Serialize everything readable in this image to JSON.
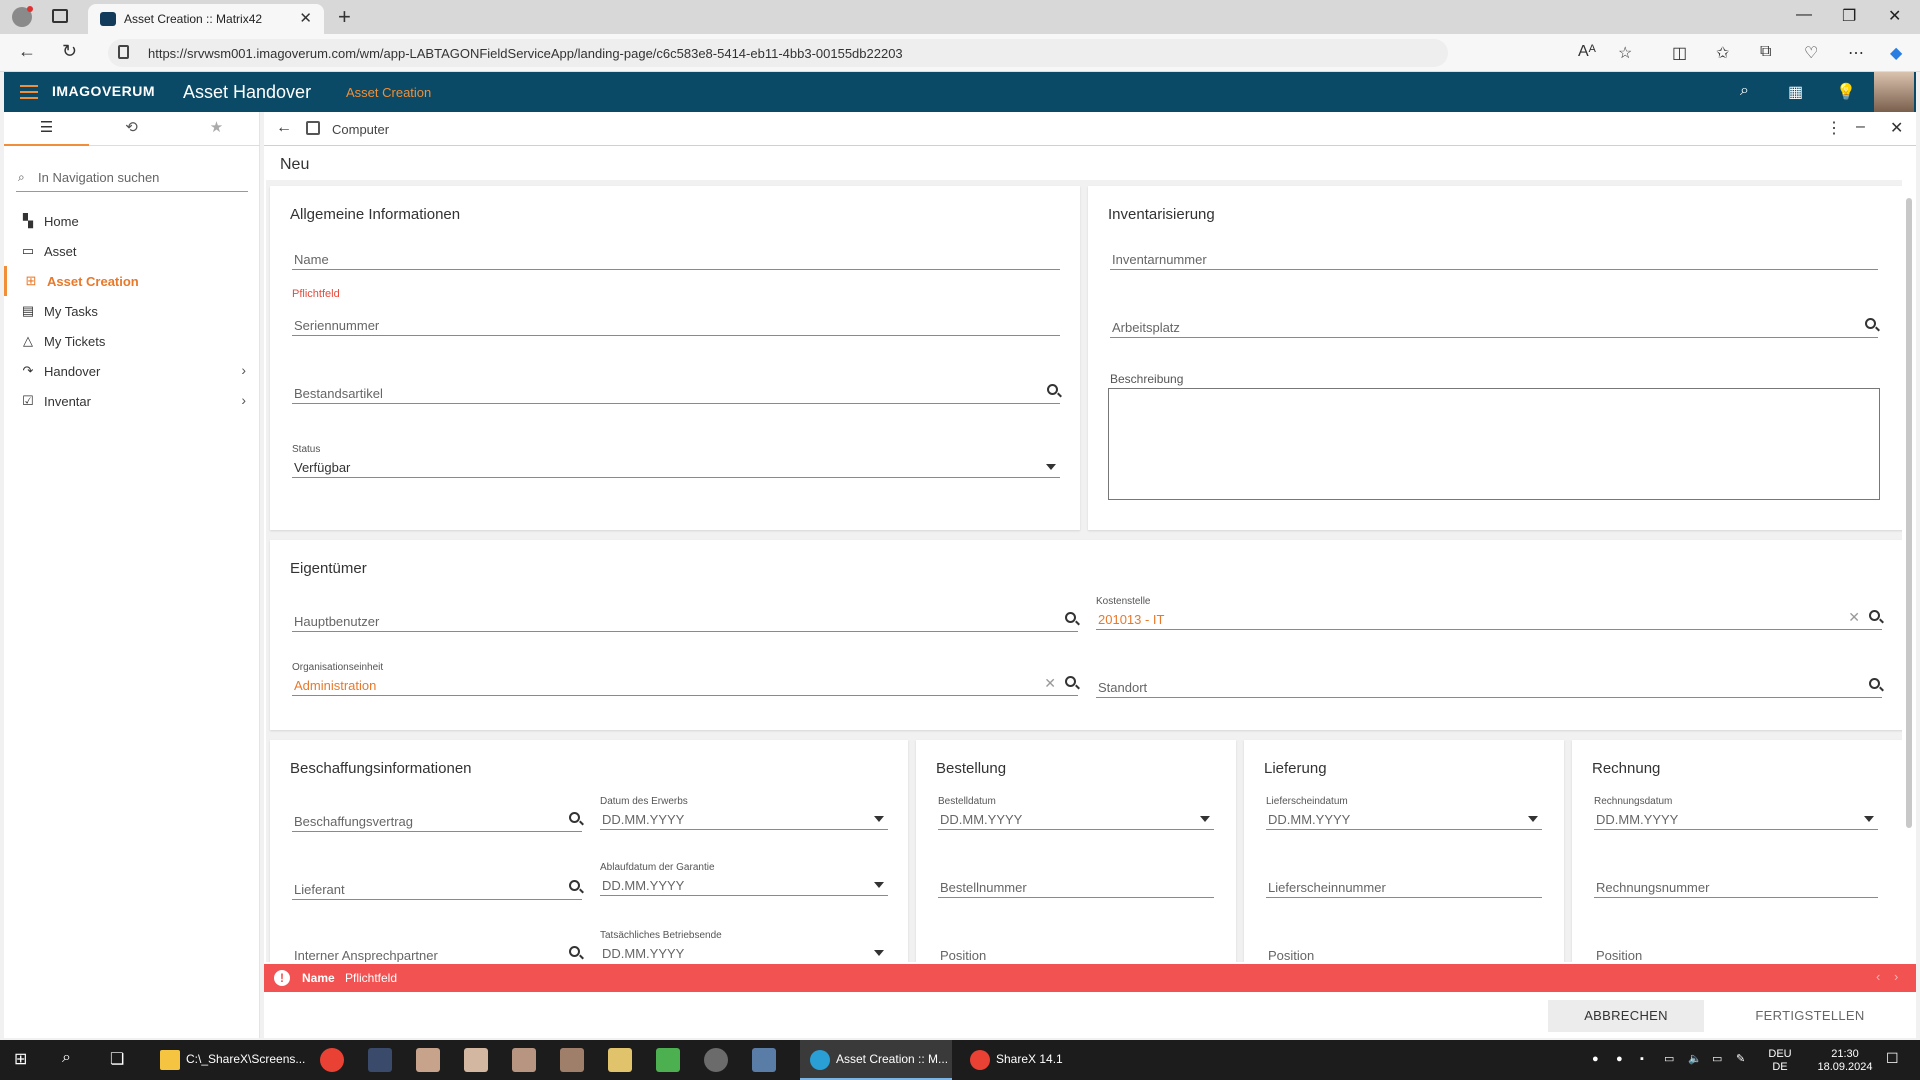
{
  "browser": {
    "tab_title": "Asset Creation :: Matrix42",
    "url": "https://srvwsm001.imagoverum.com/wm/app-LABTAGONFieldServiceApp/landing-page/c6c583e8-5414-eb11-4bb3-00155db22203"
  },
  "app": {
    "logo": "IMAGOVERUM",
    "title": "Asset Handover",
    "subtitle": "Asset Creation"
  },
  "nav": {
    "search_placeholder": "In Navigation suchen",
    "items": [
      {
        "label": "Home",
        "icon": "dashboard-icon"
      },
      {
        "label": "Asset",
        "icon": "laptop-icon"
      },
      {
        "label": "Asset Creation",
        "icon": "asset-creation-icon",
        "active": true
      },
      {
        "label": "My Tasks",
        "icon": "clipboard-icon"
      },
      {
        "label": "My Tickets",
        "icon": "warning-icon"
      },
      {
        "label": "Handover",
        "icon": "handover-icon",
        "has_children": true
      },
      {
        "label": "Inventar",
        "icon": "checkbox-icon",
        "has_children": true
      }
    ]
  },
  "breadcrumb": {
    "label": "Computer"
  },
  "page": {
    "title": "Neu"
  },
  "sections": {
    "general": {
      "title": "Allgemeine Informationen",
      "name": "Name",
      "required_msg": "Pflichtfeld",
      "serial": "Seriennummer",
      "stock_item": "Bestandsartikel",
      "status_label": "Status",
      "status_value": "Verfügbar"
    },
    "inventory": {
      "title": "Inventarisierung",
      "number": "Inventarnummer",
      "workplace": "Arbeitsplatz",
      "description": "Beschreibung"
    },
    "owner": {
      "title": "Eigentümer",
      "main_user": "Hauptbenutzer",
      "cost_center_label": "Kostenstelle",
      "cost_center_value": "201013 - IT",
      "org_unit_label": "Organisationseinheit",
      "org_unit_value": "Administration",
      "location": "Standort"
    },
    "procurement": {
      "title": "Beschaffungsinformationen",
      "contract": "Beschaffungsvertrag",
      "acq_date_label": "Datum des Erwerbs",
      "date_placeholder": "DD.MM.YYYY",
      "supplier": "Lieferant",
      "warranty_label": "Ablaufdatum der Garantie",
      "contact": "Interner Ansprechpartner",
      "end_of_life_label": "Tatsächliches Betriebsende"
    },
    "order": {
      "title": "Bestellung",
      "date_label": "Bestelldatum",
      "number": "Bestellnummer",
      "position": "Position"
    },
    "delivery": {
      "title": "Lieferung",
      "date_label": "Lieferscheindatum",
      "number": "Lieferscheinnummer",
      "position": "Position"
    },
    "invoice": {
      "title": "Rechnung",
      "date_label": "Rechnungsdatum",
      "number": "Rechnungsnummer",
      "position": "Position"
    }
  },
  "error": {
    "field": "Name",
    "message": "Pflichtfeld"
  },
  "footer": {
    "cancel": "ABBRECHEN",
    "finish": "FERTIGSTELLEN"
  },
  "taskbar": {
    "explorer": "C:\\_ShareX\\Screens...",
    "edge": "Asset Creation :: M...",
    "sharex": "ShareX 14.1",
    "lang_top": "DEU",
    "lang_bottom": "DE",
    "time": "21:30",
    "date": "18.09.2024"
  },
  "colors": {
    "header_bg": "#0b4a66",
    "accent": "#f08e3a",
    "error": "#f25252"
  }
}
